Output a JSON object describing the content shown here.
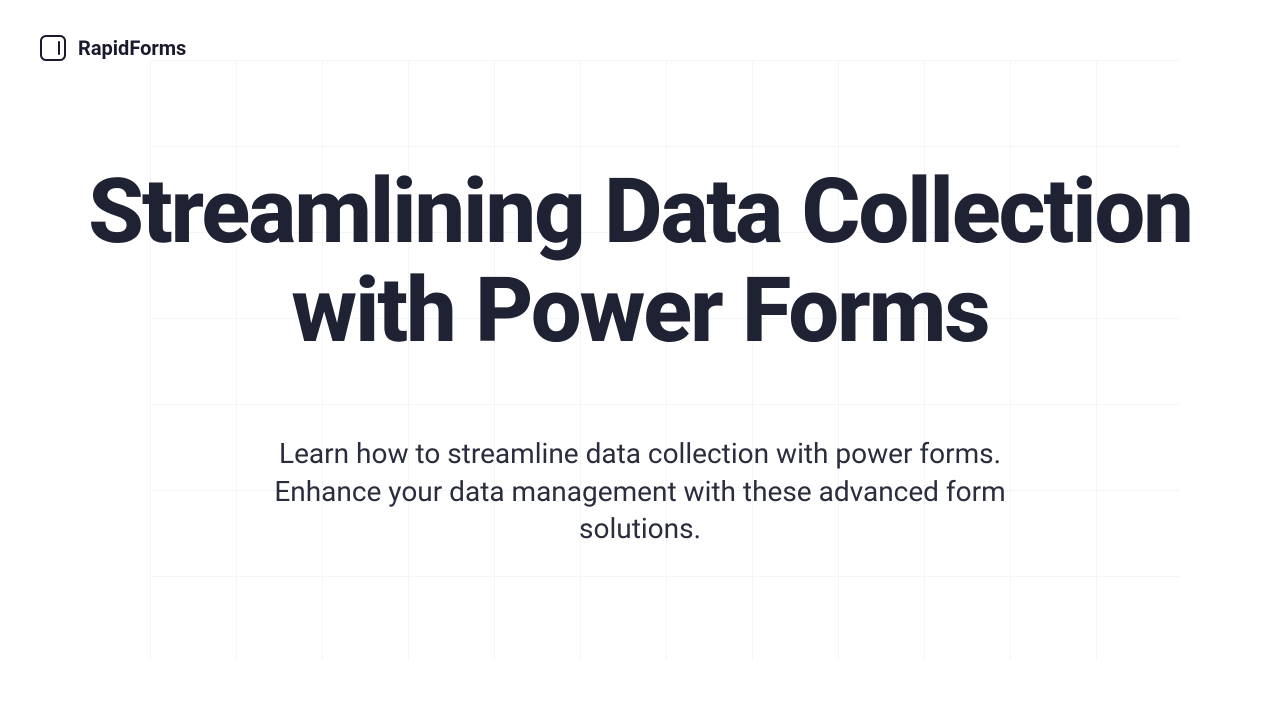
{
  "brand": {
    "name": "RapidForms"
  },
  "hero": {
    "title": "Streamlining Data Collection with Power Forms",
    "subtitle": "Learn how to streamline data collection with power forms. Enhance your data management with these advanced form solutions."
  }
}
